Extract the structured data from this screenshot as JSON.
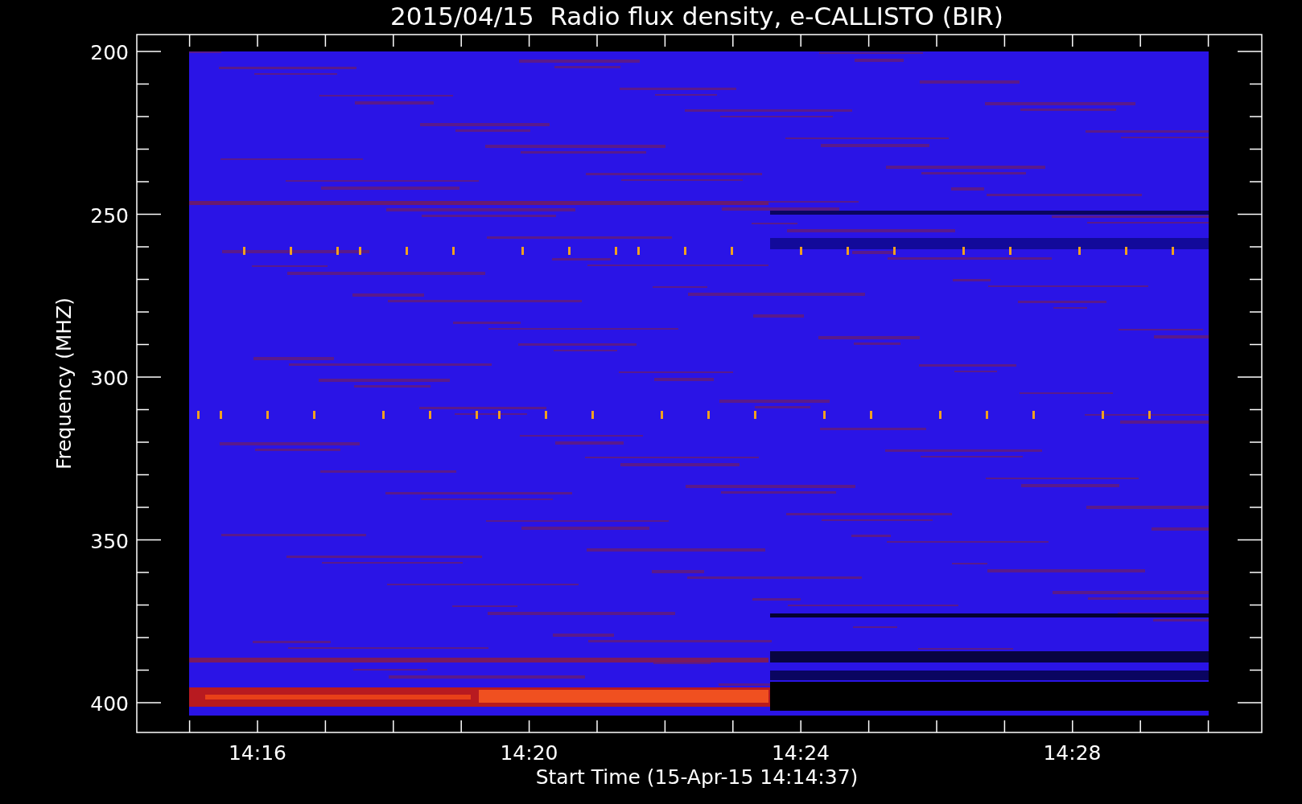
{
  "title": "2015/04/15  Radio flux density, e-CALLISTO (BIR)",
  "y_axis": {
    "label": "Frequency (MHZ)",
    "ticks": [
      "200",
      "250",
      "300",
      "350",
      "400"
    ]
  },
  "x_axis": {
    "label": "Start Time (15-Apr-15 14:14:37)",
    "ticks": [
      "14:16",
      "14:20",
      "14:24",
      "14:28"
    ]
  }
}
